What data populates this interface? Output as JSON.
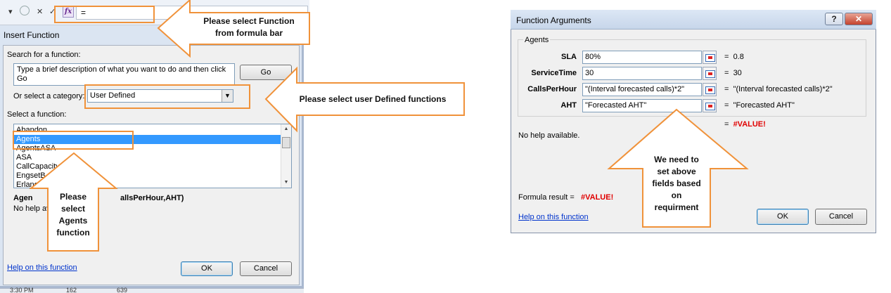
{
  "formula_bar": {
    "dropdown_glyph": "▾",
    "cancel_glyph": "✕",
    "enter_glyph": "✓",
    "fx_label": "fx",
    "value": "="
  },
  "insert_function": {
    "title": "Insert Function",
    "search_label": "Search for a function:",
    "search_value": "Type a brief description of what you want to do and then click Go",
    "go_button": "Go",
    "category_label": "Or select a category:",
    "category_value": "User Defined",
    "select_label": "Select a function:",
    "functions": [
      "Abandon",
      "Agents",
      "AgentsASA",
      "ASA",
      "CallCapacity",
      "EngsetB",
      "ErlangB"
    ],
    "selected_index": 1,
    "signature_fragment_left": "Agen",
    "signature_fragment_right": "allsPerHour,AHT)",
    "help_fragment": "No help av",
    "help_link": "Help on this function",
    "ok_button": "OK",
    "cancel_button": "Cancel",
    "sheet_row": {
      "time": "3:30 PM",
      "a": "162",
      "b": "639"
    }
  },
  "function_arguments": {
    "title": "Function Arguments",
    "help_button": "?",
    "close_button": "✕",
    "group_label": "Agents",
    "args": [
      {
        "name": "SLA",
        "value": "80%",
        "result": "0.8"
      },
      {
        "name": "ServiceTime",
        "value": "30",
        "result": "30"
      },
      {
        "name": "CallsPerHour",
        "value": "\"(Interval forecasted calls)*2\"",
        "result": "\"(Interval forecasted calls)*2\""
      },
      {
        "name": "AHT",
        "value": "\"Forecasted AHT\"",
        "result": "\"Forecasted AHT\""
      }
    ],
    "equals": "=",
    "total_result": "#VALUE!",
    "no_help": "No help available.",
    "formula_result_label": "Formula result =",
    "formula_result_value": "#VALUE!",
    "help_link": "Help on this function",
    "ok_button": "OK",
    "cancel_button": "Cancel"
  },
  "callouts": {
    "formula_bar": [
      "Please select Function",
      "from formula bar"
    ],
    "user_defined": [
      "Please select user Defined functions"
    ],
    "agents": [
      "Please",
      "select",
      "Agents",
      "function"
    ],
    "fields": [
      "We need to",
      "set above",
      "fields based",
      "on",
      "requirment"
    ]
  },
  "colors": {
    "callout_border": "#f0923a",
    "selection": "#3399ff",
    "error": "#e00000",
    "link": "#0033cc"
  }
}
